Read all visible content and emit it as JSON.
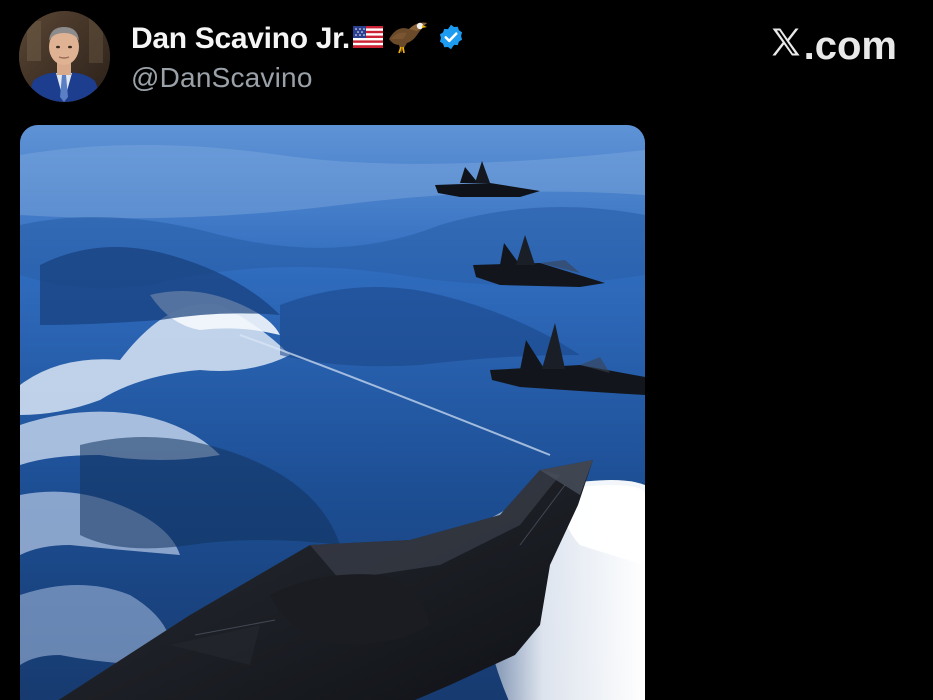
{
  "post": {
    "author": {
      "display_name": "Dan Scavino Jr.",
      "handle": "@DanScavino",
      "badges": [
        "flag-us-icon",
        "eagle-icon",
        "verified-badge-icon"
      ],
      "verified_color": "#1d9bf0"
    },
    "brand": {
      "logo_icon": "x-logo-icon",
      "text": ".com"
    },
    "media": {
      "type": "image",
      "subject_icons": [
        "fighter-jet-icon",
        "stealth-bomber-icon"
      ]
    }
  },
  "colors": {
    "background": "#000000",
    "name_text": "#f5f5f5",
    "handle_text": "#9aa1a8",
    "verified": "#1d9bf0"
  }
}
